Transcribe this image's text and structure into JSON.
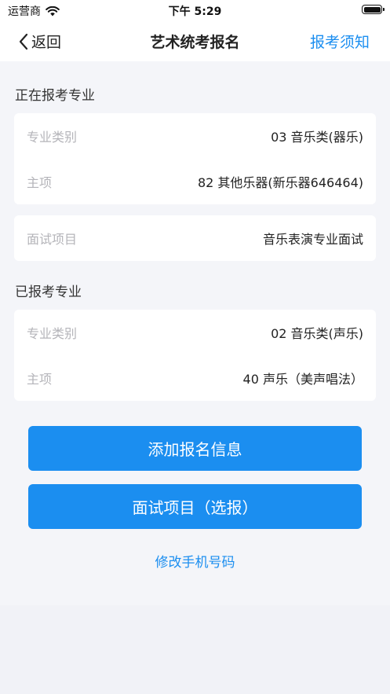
{
  "status_bar": {
    "carrier": "运营商",
    "time": "下午 5:29"
  },
  "nav": {
    "back_label": "返回",
    "title": "艺术统考报名",
    "notice_link": "报考须知"
  },
  "current_major": {
    "section_title": "正在报考专业",
    "category_label": "专业类别",
    "category_value": "03 音乐类(器乐)",
    "main_label": "主项",
    "main_value": "82 其他乐器(新乐器646464)",
    "interview_label": "面试项目",
    "interview_value": "音乐表演专业面试"
  },
  "applied_major": {
    "section_title": "已报考专业",
    "category_label": "专业类别",
    "category_value": "02 音乐类(声乐)",
    "main_label": "主项",
    "main_value": "40 声乐（美声唱法）"
  },
  "actions": {
    "add_info": "添加报名信息",
    "interview_optional": "面试项目（选报）",
    "change_phone": "修改手机号码"
  },
  "colors": {
    "accent": "#1b8ef0",
    "background": "#f4f5f9",
    "label_gray": "#b4b4b9"
  }
}
